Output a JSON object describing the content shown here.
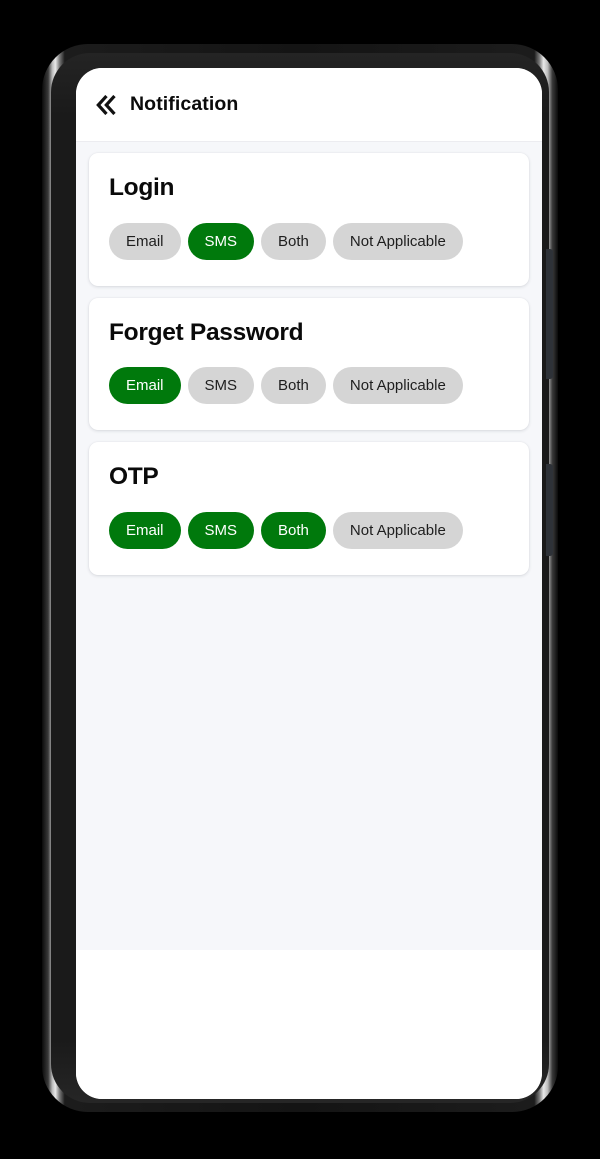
{
  "appbar": {
    "back_icon": "double-chevron-left-icon",
    "title": "Notification"
  },
  "theme": {
    "selected_color": "#00790c",
    "unselected_color": "#d5d5d5",
    "screen_bg": "#ffffff",
    "content_bg": "#f6f7fa",
    "card_bg": "#ffffff",
    "text_color": "#0a0a0a"
  },
  "cards": [
    {
      "title": "Login",
      "options": [
        {
          "label": "Email",
          "selected": false
        },
        {
          "label": "SMS",
          "selected": true
        },
        {
          "label": "Both",
          "selected": false
        },
        {
          "label": "Not Applicable",
          "selected": false
        }
      ]
    },
    {
      "title": "Forget Password",
      "options": [
        {
          "label": "Email",
          "selected": true
        },
        {
          "label": "SMS",
          "selected": false
        },
        {
          "label": "Both",
          "selected": false
        },
        {
          "label": "Not Applicable",
          "selected": false
        }
      ]
    },
    {
      "title": "OTP",
      "options": [
        {
          "label": "Email",
          "selected": true
        },
        {
          "label": "SMS",
          "selected": true
        },
        {
          "label": "Both",
          "selected": true
        },
        {
          "label": "Not Applicable",
          "selected": false
        }
      ]
    }
  ],
  "device": {
    "volume_button": "volume-rocker",
    "power_button": "power-button"
  }
}
